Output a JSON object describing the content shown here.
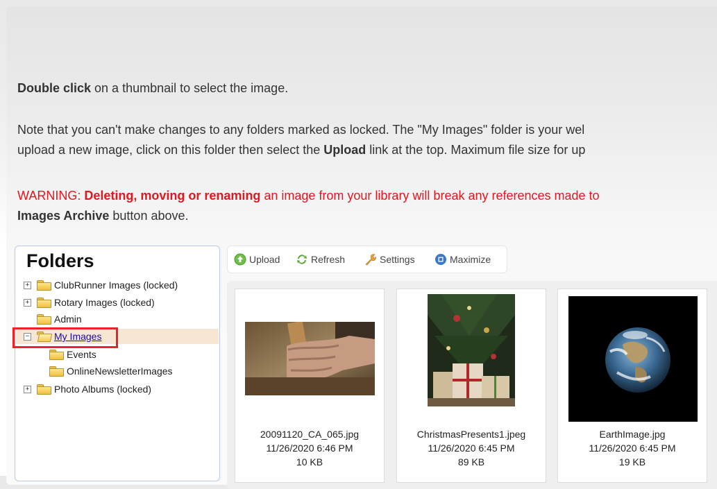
{
  "intro": {
    "p1_bold": "Double click",
    "p1_rest": " on a thumbnail to select the image.",
    "p2_line1": "Note that you can't make changes to any folders marked as locked. The \"My Images\" folder is your wel",
    "p2_line2_a": "upload a new image, click on this folder then select the ",
    "p2_line2_bold": "Upload",
    "p2_line2_b": " link at the top. Maximum file size for up",
    "p3_prefix": "WARNING: ",
    "p3_bold": "Deleting, moving or renaming",
    "p3_rest": " an image from your library will break any references made to",
    "p3_line2_bold": "Images Archive",
    "p3_line2_rest": " button above."
  },
  "folders": {
    "title": "Folders",
    "items": [
      {
        "label": "ClubRunner Images (locked)",
        "expander": "+"
      },
      {
        "label": "Rotary Images (locked)",
        "expander": "+"
      },
      {
        "label": "Admin",
        "expander": ""
      },
      {
        "label": "My Images",
        "expander": "−",
        "selected": true
      },
      {
        "label": "Events",
        "expander": ""
      },
      {
        "label": "OnlineNewsletterImages",
        "expander": ""
      },
      {
        "label": "Photo Albums (locked)",
        "expander": "+"
      }
    ]
  },
  "toolbar": {
    "upload": "Upload",
    "refresh": "Refresh",
    "settings": "Settings",
    "maximize": "Maximize"
  },
  "images": [
    {
      "name": "20091120_CA_065.jpg",
      "date": "11/26/2020 6:46 PM",
      "size": "10 KB"
    },
    {
      "name": "ChristmasPresents1.jpeg",
      "date": "11/26/2020 6:45 PM",
      "size": "89 KB"
    },
    {
      "name": "EarthImage.jpg",
      "date": "11/26/2020 6:45 PM",
      "size": "19 KB"
    }
  ],
  "colors": {
    "warning": "#e4161f",
    "highlight": "#e8242a",
    "selected_row": "#f7e6d1",
    "link": "#1a0dab"
  }
}
